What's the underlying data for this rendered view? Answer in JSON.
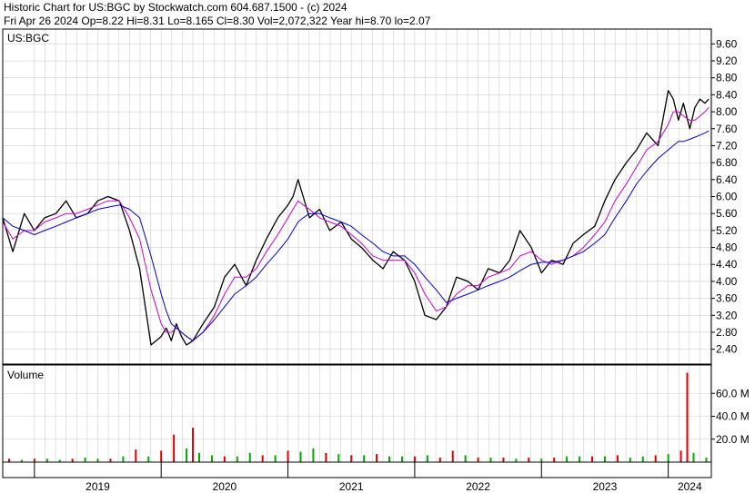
{
  "header": {
    "line1": "Historic Chart for US:BGC by Stockwatch.com 604.687.1500 - (c) 2024",
    "line2": "Fri Apr 26 2024  Op=8.22  Hi=8.31  Lo=8.165  Cl=8.30  Vol=2,072,322  Year hi=8.70  lo=2.07"
  },
  "price_panel": {
    "label": "US:BGC"
  },
  "volume_panel": {
    "label": "Volume"
  },
  "x_axis": {
    "labels": [
      "2019",
      "2020",
      "2021",
      "2022",
      "2023",
      "2024"
    ]
  },
  "colors": {
    "price": "#000000",
    "ma_short": "#cc00cc",
    "ma_long": "#0000cc",
    "vol_up": "#00aa00",
    "vol_down": "#dd0000",
    "grid": "#cfcfcf",
    "frame": "#000000"
  },
  "chart_data": [
    {
      "type": "line",
      "title": "US:BGC",
      "yticks": [
        "9.60",
        "9.20",
        "8.80",
        "8.40",
        "8.00",
        "7.60",
        "7.20",
        "6.80",
        "6.40",
        "6.00",
        "5.60",
        "5.20",
        "4.80",
        "4.40",
        "4.00",
        "3.60",
        "3.20",
        "2.80",
        "2.40"
      ],
      "ylim": [
        2.05,
        9.95
      ],
      "xlim": [
        2018.75,
        2024.34
      ],
      "x": [
        2018.75,
        2018.83,
        2018.92,
        2019.0,
        2019.08,
        2019.17,
        2019.25,
        2019.33,
        2019.42,
        2019.5,
        2019.58,
        2019.67,
        2019.75,
        2019.83,
        2019.92,
        2020.0,
        2020.04,
        2020.08,
        2020.12,
        2020.16,
        2020.2,
        2020.25,
        2020.33,
        2020.42,
        2020.5,
        2020.58,
        2020.67,
        2020.75,
        2020.83,
        2020.92,
        2021.0,
        2021.04,
        2021.08,
        2021.12,
        2021.17,
        2021.25,
        2021.33,
        2021.42,
        2021.5,
        2021.58,
        2021.67,
        2021.75,
        2021.83,
        2021.92,
        2022.0,
        2022.08,
        2022.17,
        2022.25,
        2022.33,
        2022.42,
        2022.5,
        2022.58,
        2022.67,
        2022.75,
        2022.83,
        2022.92,
        2023.0,
        2023.08,
        2023.17,
        2023.25,
        2023.33,
        2023.42,
        2023.5,
        2023.58,
        2023.67,
        2023.75,
        2023.83,
        2023.92,
        2024.0,
        2024.04,
        2024.08,
        2024.12,
        2024.17,
        2024.21,
        2024.25,
        2024.29,
        2024.32
      ],
      "series": [
        {
          "values": [
            5.5,
            4.7,
            5.6,
            5.2,
            5.5,
            5.6,
            5.9,
            5.5,
            5.6,
            5.9,
            6.0,
            5.9,
            5.2,
            4.3,
            2.5,
            2.7,
            2.9,
            2.6,
            3.0,
            2.7,
            2.5,
            2.6,
            3.0,
            3.4,
            4.1,
            4.4,
            3.9,
            4.5,
            5.0,
            5.5,
            5.8,
            6.0,
            6.4,
            6.0,
            5.5,
            5.7,
            5.2,
            5.4,
            5.0,
            4.8,
            4.5,
            4.3,
            4.7,
            4.5,
            4.0,
            3.2,
            3.1,
            3.4,
            4.1,
            4.0,
            3.8,
            4.3,
            4.2,
            4.5,
            5.2,
            4.8,
            4.2,
            4.5,
            4.4,
            4.9,
            5.1,
            5.3,
            5.9,
            6.4,
            6.8,
            7.1,
            7.5,
            7.2,
            8.5,
            8.3,
            7.8,
            8.2,
            7.6,
            8.1,
            8.3,
            8.2,
            8.3
          ]
        },
        {
          "values": [
            5.4,
            5.0,
            5.2,
            5.2,
            5.4,
            5.5,
            5.6,
            5.6,
            5.7,
            5.8,
            5.9,
            5.9,
            5.5,
            5.0,
            3.8,
            3.0,
            2.8,
            2.8,
            2.9,
            2.8,
            2.7,
            2.6,
            2.8,
            3.2,
            3.7,
            4.1,
            4.1,
            4.3,
            4.7,
            5.1,
            5.5,
            5.7,
            5.9,
            5.8,
            5.7,
            5.5,
            5.4,
            5.3,
            5.1,
            4.9,
            4.6,
            4.5,
            4.5,
            4.5,
            4.2,
            3.7,
            3.3,
            3.4,
            3.7,
            3.9,
            3.9,
            4.1,
            4.2,
            4.3,
            4.6,
            4.7,
            4.5,
            4.4,
            4.5,
            4.6,
            4.8,
            5.1,
            5.4,
            5.9,
            6.3,
            6.7,
            7.1,
            7.3,
            7.7,
            8.0,
            8.0,
            7.9,
            7.8,
            7.8,
            7.9,
            8.0,
            8.1
          ]
        },
        {
          "values": [
            5.5,
            5.3,
            5.2,
            5.1,
            5.2,
            5.3,
            5.4,
            5.5,
            5.6,
            5.7,
            5.75,
            5.8,
            5.7,
            5.5,
            4.6,
            3.7,
            3.3,
            3.0,
            2.9,
            2.8,
            2.7,
            2.6,
            2.8,
            3.1,
            3.4,
            3.7,
            3.9,
            4.1,
            4.4,
            4.7,
            5.0,
            5.2,
            5.4,
            5.5,
            5.6,
            5.6,
            5.5,
            5.4,
            5.3,
            5.1,
            4.9,
            4.7,
            4.6,
            4.6,
            4.4,
            4.1,
            3.8,
            3.5,
            3.6,
            3.7,
            3.8,
            3.9,
            4.0,
            4.1,
            4.25,
            4.4,
            4.45,
            4.45,
            4.5,
            4.6,
            4.7,
            4.9,
            5.1,
            5.5,
            5.9,
            6.3,
            6.6,
            6.9,
            7.1,
            7.2,
            7.3,
            7.3,
            7.35,
            7.4,
            7.45,
            7.5,
            7.55
          ]
        }
      ]
    },
    {
      "type": "bar",
      "title": "Volume",
      "yticks": [
        "60.0 M",
        "40.0 M",
        "20.0 M"
      ],
      "ylim": [
        0,
        80
      ],
      "xlim": [
        2018.75,
        2024.34
      ],
      "x": [
        2018.8,
        2018.9,
        2019.0,
        2019.1,
        2019.2,
        2019.3,
        2019.4,
        2019.5,
        2019.6,
        2019.7,
        2019.8,
        2019.9,
        2020.0,
        2020.1,
        2020.2,
        2020.25,
        2020.3,
        2020.4,
        2020.5,
        2020.6,
        2020.7,
        2020.8,
        2020.9,
        2021.0,
        2021.1,
        2021.2,
        2021.3,
        2021.4,
        2021.5,
        2021.6,
        2021.7,
        2021.8,
        2021.9,
        2022.0,
        2022.1,
        2022.2,
        2022.3,
        2022.4,
        2022.5,
        2022.6,
        2022.7,
        2022.8,
        2022.9,
        2023.0,
        2023.1,
        2023.2,
        2023.3,
        2023.4,
        2023.5,
        2023.6,
        2023.7,
        2023.8,
        2023.9,
        2024.0,
        2024.1,
        2024.15,
        2024.2,
        2024.3
      ],
      "values": [
        3,
        2,
        3,
        3,
        2,
        3,
        4,
        3,
        3,
        5,
        11,
        5,
        10,
        24,
        12,
        30,
        8,
        6,
        5,
        5,
        8,
        6,
        6,
        10,
        9,
        12,
        8,
        7,
        6,
        6,
        7,
        5,
        5,
        5,
        6,
        4,
        10,
        6,
        4,
        4,
        4,
        3,
        4,
        3,
        4,
        5,
        5,
        5,
        5,
        6,
        4,
        5,
        6,
        7,
        10,
        78,
        8,
        4
      ],
      "up": [
        false,
        true,
        false,
        true,
        true,
        false,
        true,
        true,
        false,
        true,
        false,
        true,
        false,
        false,
        true,
        false,
        true,
        true,
        false,
        true,
        true,
        false,
        true,
        false,
        true,
        true,
        false,
        true,
        false,
        true,
        false,
        true,
        true,
        false,
        true,
        false,
        false,
        true,
        false,
        true,
        false,
        true,
        false,
        true,
        false,
        true,
        true,
        false,
        true,
        false,
        true,
        true,
        false,
        true,
        false,
        false,
        true,
        true
      ]
    }
  ]
}
